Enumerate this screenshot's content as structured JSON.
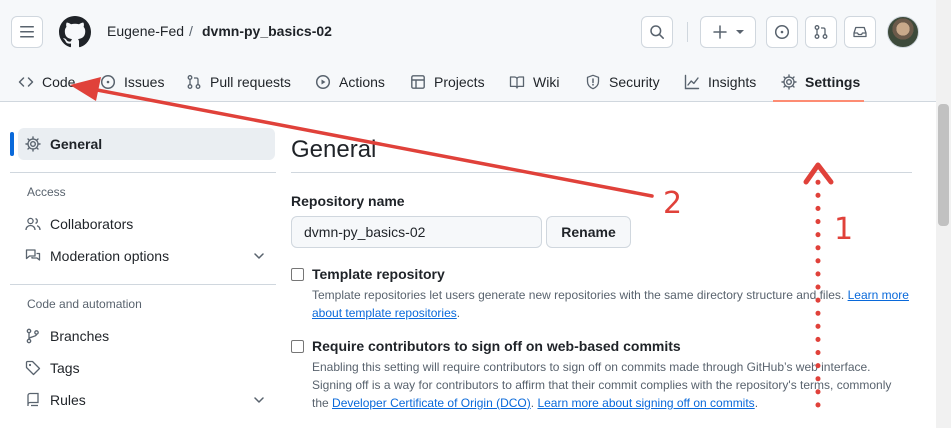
{
  "header": {
    "owner": "Eugene-Fed",
    "separator": "/",
    "repo": "dvmn-py_basics-02"
  },
  "tabs": [
    {
      "label": "Code",
      "icon": "code-icon"
    },
    {
      "label": "Issues",
      "icon": "issue-icon"
    },
    {
      "label": "Pull requests",
      "icon": "pull-request-icon"
    },
    {
      "label": "Actions",
      "icon": "play-icon"
    },
    {
      "label": "Projects",
      "icon": "table-icon"
    },
    {
      "label": "Wiki",
      "icon": "book-icon"
    },
    {
      "label": "Security",
      "icon": "shield-icon"
    },
    {
      "label": "Insights",
      "icon": "graph-icon"
    },
    {
      "label": "Settings",
      "icon": "gear-icon",
      "active": true
    }
  ],
  "sidebar": {
    "general": "General",
    "access_heading": "Access",
    "access_items": [
      "Collaborators",
      "Moderation options"
    ],
    "code_heading": "Code and automation",
    "code_items": [
      "Branches",
      "Tags",
      "Rules"
    ]
  },
  "main": {
    "title": "General",
    "repo_name_label": "Repository name",
    "repo_name_value": "dvmn-py_basics-02",
    "rename_label": "Rename",
    "template": {
      "label": "Template repository",
      "desc": "Template repositories let users generate new repositories with the same directory structure and files.",
      "link": "Learn more about template repositories",
      "tail": "."
    },
    "signoff": {
      "label": "Require contributors to sign off on web-based commits",
      "desc1": "Enabling this setting will require contributors to sign off on commits made through GitHub’s web interface. Signing off is a way for contributors to affirm that their commit complies with the repository's terms, commonly the",
      "link1": "Developer Certificate of Origin (DCO)",
      "mid": ".",
      "link2": "Learn more about signing off on commits",
      "tail": "."
    }
  },
  "annotations": {
    "one": "1",
    "two": "2"
  },
  "colors": {
    "accent": "#0969da",
    "tab_underline": "#fd8c73",
    "annotation": "#e0413a"
  }
}
